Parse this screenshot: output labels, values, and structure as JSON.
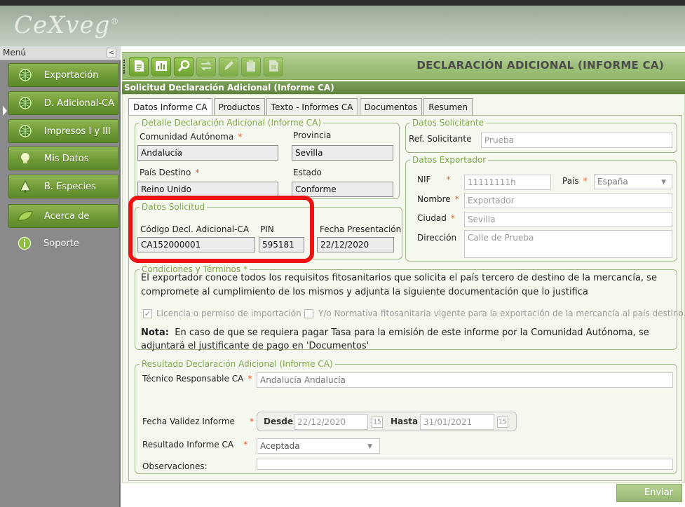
{
  "app": {
    "logo_text": "CeXveg",
    "logo_mark": "®"
  },
  "menu": {
    "title": "Menú",
    "collapse": "<",
    "items": [
      {
        "label": "Exportación",
        "icon": "globe-icon"
      },
      {
        "label": "D. Adicional-CA",
        "icon": "globe-icon"
      },
      {
        "label": "Impresos I y III",
        "icon": "globe-icon"
      },
      {
        "label": "Mis Datos",
        "icon": "bulb-icon"
      },
      {
        "label": "B. Especies",
        "icon": "tree-icon"
      },
      {
        "label": "Acerca de",
        "icon": "leaf-icon"
      },
      {
        "label": "Soporte",
        "icon": "info-icon"
      }
    ]
  },
  "toolbar": {
    "title": "DECLARACIÓN ADICIONAL (INFORME CA)",
    "buttons": [
      "new-document-icon",
      "chart-icon",
      "search-icon",
      "transfer-icon",
      "edit-icon",
      "print-icon",
      "document-icon"
    ]
  },
  "section_title": "Solicitud Declaración Adicional (Informe CA)",
  "tabs": [
    "Datos Informe CA",
    "Productos",
    "Texto - Informes CA",
    "Documentos",
    "Resumen"
  ],
  "detalle": {
    "legend": "Detalle Declaración Adicional (Informe CA)",
    "comunidad_label": "Comunidad Autónoma",
    "comunidad_value": "Andalucía",
    "provincia_label": "Provincia",
    "provincia_value": "Sevilla",
    "pais_label": "País Destino",
    "pais_value": "Reino Unido",
    "estado_label": "Estado",
    "estado_value": "Conforme",
    "required_mark": "*"
  },
  "solicitud": {
    "legend": "Datos Solicitud",
    "codigo_label": "Código Decl. Adicional-CA",
    "codigo_value": "CA152000001",
    "pin_label": "PIN",
    "pin_value": "595181",
    "fecha_label": "Fecha Presentación",
    "fecha_value": "22/12/2020"
  },
  "solicitante": {
    "legend": "Datos Solicitante",
    "ref_label": "Ref. Solicitante",
    "ref_value": "Prueba"
  },
  "exportador": {
    "legend": "Datos Exportador",
    "nif_label": "NIF",
    "nif_value": "11111111h",
    "pais_label": "País",
    "pais_value": "España",
    "nombre_label": "Nombre",
    "nombre_value": "Exportador",
    "ciudad_label": "Ciudad",
    "ciudad_value": "Sevilla",
    "direccion_label": "Dirección",
    "direccion_value": "Calle de Prueba"
  },
  "condiciones": {
    "legend": "Condiciones y Términos *",
    "text_line1": "El exportador conoce todos los requisitos fitosanitarios que solicita el país tercero de destino de la mercancía, se",
    "text_line2": "compromete al cumplimiento de los mismos y adjunta la siguiente documentación que lo justifica",
    "check1_label": "Licencia o permiso de importación",
    "check1_checked": true,
    "check2_label": "Y/o Normativa fitosanitaria vigente para la exportación de la mercancía al país destino.",
    "check2_checked": false,
    "nota_bold": "Nota:",
    "nota_line1": "En caso de que se requiera pagar Tasa para la emisión de este informe por la Comunidad Autónoma, se",
    "nota_line2": "adjuntará el justificante de pago en 'Documentos'"
  },
  "resultado": {
    "legend": "Resultado Declaración Adicional (Informe CA)",
    "tecnico_label": "Técnico Responsable CA",
    "tecnico_value": "Andalucía Andalucía",
    "fecha_label": "Fecha Validez Informe",
    "desde_label": "Desde",
    "desde_value": "22/12/2020",
    "hasta_label": "Hasta",
    "hasta_value": "31/01/2021",
    "cal_icon_text": "15",
    "resultado_label": "Resultado Informe CA",
    "resultado_value": "Aceptada",
    "observaciones_label": "Observaciones:",
    "observaciones_value": ""
  },
  "send_label": "Enviar",
  "colors": {
    "accent_green": "#6e9a35",
    "required": "#e55b2b",
    "highlight": "#ee1111"
  }
}
